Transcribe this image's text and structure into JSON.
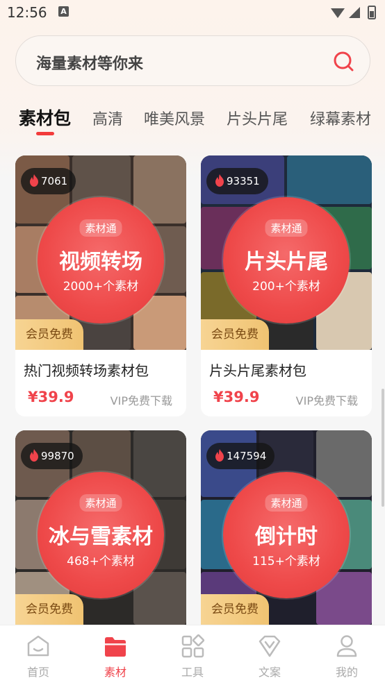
{
  "status": {
    "time": "12:56",
    "a_label": "A"
  },
  "search": {
    "placeholder": "海量素材等你来"
  },
  "tabs": [
    {
      "label": "素材包"
    },
    {
      "label": "高清"
    },
    {
      "label": "唯美风景"
    },
    {
      "label": "片头片尾"
    },
    {
      "label": "绿幕素材"
    }
  ],
  "cards": [
    {
      "hot": "7061",
      "tag": "素材通",
      "title": "视频转场",
      "count": "2000+个素材",
      "vip_badge": "会员免费",
      "name": "热门视频转场素材包",
      "price": "¥39.9",
      "vip_download": "VIP免费下载"
    },
    {
      "hot": "93351",
      "tag": "素材通",
      "title": "片头片尾",
      "count": "200+个素材",
      "vip_badge": "会员免费",
      "name": "片头片尾素材包",
      "price": "¥39.9",
      "vip_download": "VIP免费下载"
    },
    {
      "hot": "99870",
      "tag": "素材通",
      "title": "冰与雪素材",
      "count": "468+个素材",
      "vip_badge": "会员免费"
    },
    {
      "hot": "147594",
      "tag": "素材通",
      "title": "倒计时",
      "count": "115+个素材",
      "vip_badge": "会员免费"
    }
  ],
  "nav": [
    {
      "label": "首页"
    },
    {
      "label": "素材"
    },
    {
      "label": "工具"
    },
    {
      "label": "文案"
    },
    {
      "label": "我的"
    }
  ],
  "colors": {
    "accent": "#f0434b",
    "circle": "#ee4949",
    "vip_gold": "#f0c372"
  }
}
